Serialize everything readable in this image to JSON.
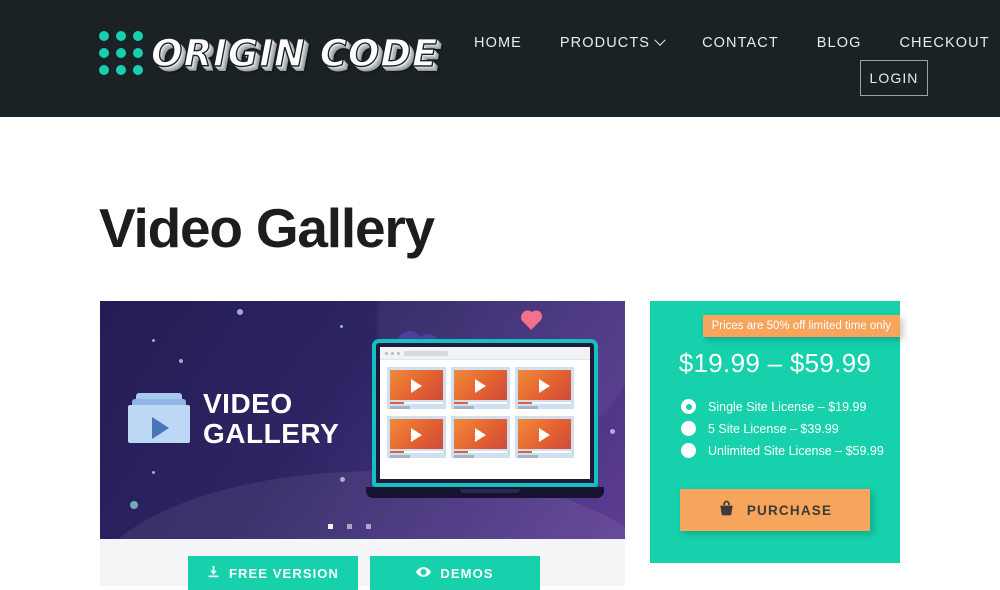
{
  "header": {
    "logo_text": "ORIGIN CODE",
    "logo_dots_icon": "dot-grid-icon",
    "nav": [
      {
        "label": "HOME",
        "has_chevron": false
      },
      {
        "label": "PRODUCTS",
        "has_chevron": true
      },
      {
        "label": "CONTACT",
        "has_chevron": false
      },
      {
        "label": "BLOG",
        "has_chevron": false
      },
      {
        "label": "CHECKOUT",
        "has_chevron": false
      }
    ],
    "login_label": "LOGIN",
    "background_color": "#1b2226",
    "accent_color": "#16d1ac"
  },
  "page": {
    "title": "Video Gallery",
    "background_color": "#ffffff"
  },
  "product_media": {
    "hero_title_line1": "VIDEO",
    "hero_title_line2": "GALLERY",
    "folder_play_icon": "video-folder-play-icon",
    "cloud_icon": "cloud-icon",
    "heart_icon": "heart-icon",
    "person_icon": "person-icon",
    "laptop_icon": "laptop-mockup",
    "thumbnail_count": 6,
    "slider_dot_count": 3,
    "active_slider_dot": 1,
    "footer_background": "#f4f5f6",
    "buttons": [
      {
        "label": "FREE VERSION",
        "icon": "download-icon"
      },
      {
        "label": "DEMOS",
        "icon": "eye-icon"
      }
    ]
  },
  "pricing": {
    "promo_text": "Prices are 50% off limited time only",
    "promo_color": "#f7a45c",
    "panel_color": "#16d1ac",
    "price_range": "$19.99 – $59.99",
    "licenses": [
      {
        "label": "Single Site License – $19.99",
        "selected": true
      },
      {
        "label": "5 Site License – $39.99",
        "selected": false
      },
      {
        "label": "Unlimited Site License – $59.99",
        "selected": false
      }
    ],
    "purchase_label": "PURCHASE",
    "purchase_icon": "shopping-basket-icon"
  }
}
